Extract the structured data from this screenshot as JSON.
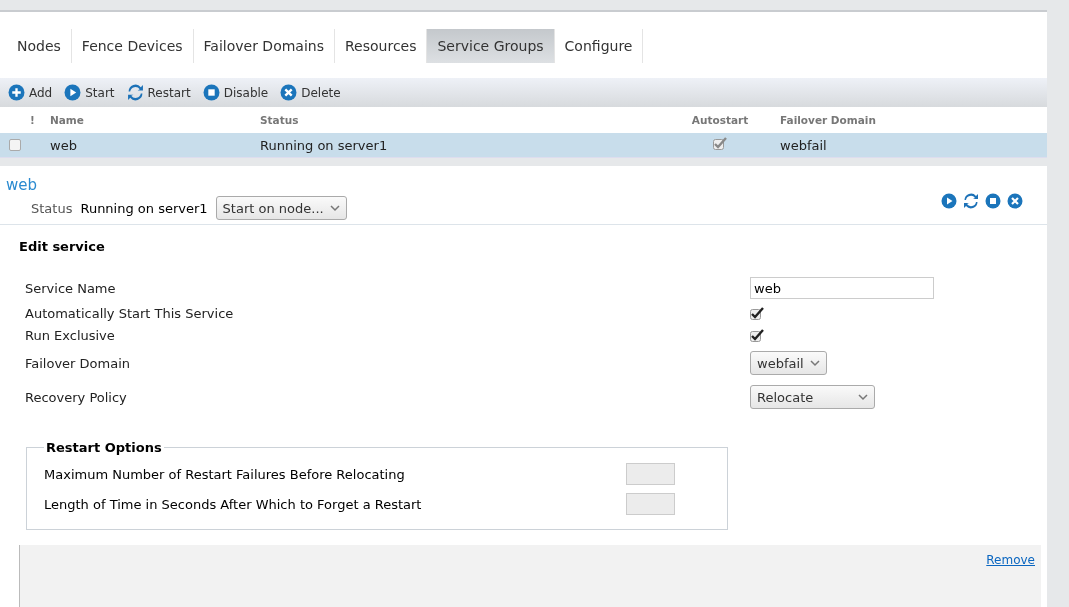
{
  "tabs": [
    {
      "label": "Nodes",
      "selected": false
    },
    {
      "label": "Fence Devices",
      "selected": false
    },
    {
      "label": "Failover Domains",
      "selected": false
    },
    {
      "label": "Resources",
      "selected": false
    },
    {
      "label": "Service Groups",
      "selected": true
    },
    {
      "label": "Configure",
      "selected": false
    }
  ],
  "toolbar": [
    {
      "label": "Add",
      "kind": "add"
    },
    {
      "label": "Start",
      "kind": "start"
    },
    {
      "label": "Restart",
      "kind": "restart"
    },
    {
      "label": "Disable",
      "kind": "disable"
    },
    {
      "label": "Delete",
      "kind": "delete"
    }
  ],
  "table": {
    "columns": [
      "!",
      "Name",
      "Status",
      "Autostart",
      "Failover Domain"
    ],
    "rows": [
      {
        "selected": true,
        "checked": false,
        "name": "web",
        "status": "Running on server1",
        "autostart": true,
        "failover_domain": "webfail"
      }
    ]
  },
  "detail": {
    "title": "web",
    "status_label": "Status",
    "status": "Running on server1",
    "node_select": "Start on node...",
    "actions": [
      {
        "kind": "start"
      },
      {
        "kind": "restart"
      },
      {
        "kind": "disable"
      },
      {
        "kind": "delete"
      }
    ]
  },
  "edit": {
    "heading": "Edit service",
    "fields": [
      {
        "label": "Service Name",
        "kind": "text",
        "value": "web"
      },
      {
        "label": "Automatically Start This Service",
        "kind": "checkbox",
        "checked": true
      },
      {
        "label": "Run Exclusive",
        "kind": "checkbox",
        "checked": true
      },
      {
        "label": "Failover Domain",
        "kind": "select",
        "value": "webfail"
      },
      {
        "label": "Recovery Policy",
        "kind": "select",
        "value": "Relocate",
        "wide": true
      }
    ]
  },
  "restart_options": {
    "legend": "Restart Options",
    "fields": [
      {
        "label": "Maximum Number of Restart Failures Before Relocating",
        "disabled": true
      },
      {
        "label": "Length of Time in Seconds After Which to Forget a Restart",
        "disabled": true
      }
    ]
  },
  "remove_link": "Remove"
}
